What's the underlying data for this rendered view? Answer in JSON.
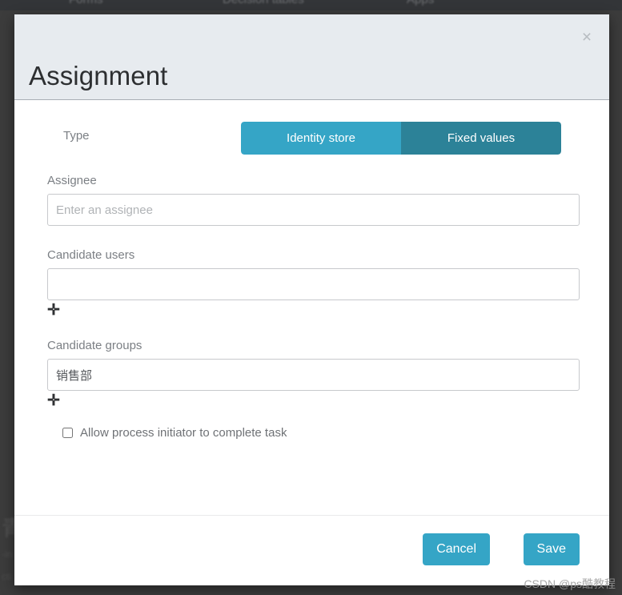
{
  "background": {
    "navbar_items": [
      "Forms",
      "Decision tables",
      "Apps"
    ],
    "ghost_texts": [
      "青",
      "-in",
      "cti"
    ]
  },
  "modal": {
    "title": "Assignment",
    "close_icon": "×",
    "type": {
      "label": "Type",
      "options": [
        "Identity store",
        "Fixed values"
      ],
      "selected": "Identity store",
      "active_color": "#35a5c6",
      "inactive_color": "#2c8298"
    },
    "fields": {
      "assignee": {
        "label": "Assignee",
        "value": "",
        "placeholder": "Enter an assignee"
      },
      "candidate_users": {
        "label": "Candidate users",
        "value": "",
        "placeholder": "",
        "add_icon": "✛"
      },
      "candidate_groups": {
        "label": "Candidate groups",
        "value": "销售部",
        "placeholder": "",
        "add_icon": "✛"
      }
    },
    "checkbox": {
      "label": "Allow process initiator to complete task",
      "checked": false
    },
    "footer": {
      "cancel_label": "Cancel",
      "save_label": "Save",
      "button_color": "#35a5c6"
    }
  },
  "watermark": "CSDN @ps酷教程"
}
